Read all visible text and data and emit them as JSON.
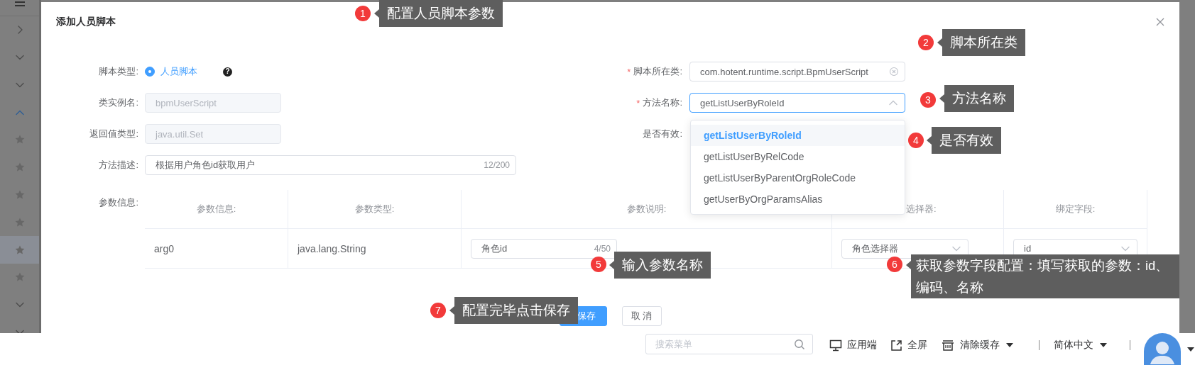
{
  "sidebar": {
    "items": [
      {
        "kind": "menu"
      },
      {
        "kind": "collapse"
      },
      {
        "kind": "group",
        "expanded": false
      },
      {
        "kind": "group",
        "expanded": false
      },
      {
        "kind": "group",
        "expanded": true
      },
      {
        "kind": "page",
        "selected": false
      },
      {
        "kind": "page",
        "selected": false
      },
      {
        "kind": "page",
        "selected": false
      },
      {
        "kind": "page",
        "selected": false
      },
      {
        "kind": "page",
        "selected": true
      },
      {
        "kind": "page",
        "selected": false
      },
      {
        "kind": "group",
        "expanded": false
      },
      {
        "kind": "group",
        "expanded": false
      }
    ]
  },
  "dialog": {
    "title": "添加人员脚本",
    "fields": [
      {
        "kind": "radio",
        "label": "脚本类型:",
        "options": [
          {
            "label": "人员脚本",
            "selected": true
          }
        ],
        "help": "?"
      },
      {
        "kind": "text",
        "required_mark": "*",
        "label": "脚本所在类:",
        "value": "com.hotent.runtime.script.BpmUserScript",
        "disabled": false,
        "clearable": true
      },
      {
        "kind": "text",
        "label": "类实例名:",
        "value": "bpmUserScript",
        "disabled": true
      },
      {
        "kind": "select",
        "required_mark": "*",
        "label": "方法名称:",
        "value": "getListUserByRoleId",
        "expanded": true,
        "options": [
          {
            "label": "getListUserByRoleId",
            "selected": true
          },
          {
            "label": "getListUserByRelCode",
            "selected": false
          },
          {
            "label": "getListUserByParentOrgRoleCode",
            "selected": false
          },
          {
            "label": "getUserByOrgParamsAlias",
            "selected": false
          }
        ]
      },
      {
        "kind": "text",
        "label": "返回值类型:",
        "value": "java.util.Set",
        "disabled": true
      },
      {
        "kind": "hidden",
        "label": "是否有效:"
      },
      {
        "kind": "text",
        "label": "方法描述:",
        "value": "根据用户角色id获取用户",
        "count": "12/200",
        "disabled": false
      }
    ],
    "params": {
      "label": "参数信息:",
      "columns": [
        "参数信息:",
        "参数类型:",
        "参数说明:",
        "选择器:",
        "绑定字段:"
      ],
      "rows": [
        {
          "name": "arg0",
          "type": "java.lang.String",
          "description": {
            "value": "角色id",
            "count": "4/50"
          },
          "selector": {
            "value": "角色选择器"
          },
          "field": {
            "value": "id"
          }
        }
      ]
    },
    "buttons": [
      {
        "kind": "primary",
        "label": "保存"
      },
      {
        "kind": "default",
        "label": "取 消"
      }
    ]
  },
  "annotations": [
    {
      "number": "1",
      "text": "配置人员脚本参数"
    },
    {
      "number": "2",
      "text": "脚本所在类"
    },
    {
      "number": "3",
      "text": "方法名称"
    },
    {
      "number": "4",
      "text": "是否有效"
    },
    {
      "number": "5",
      "text": "输入参数名称"
    },
    {
      "number": "6",
      "text": "获取参数字段配置：填写获取的参数：id、编码、名称"
    },
    {
      "number": "7",
      "text": "配置完毕点击保存"
    }
  ],
  "header_bar": {
    "search": {
      "placeholder": "搜索菜单"
    },
    "items": [
      {
        "kind": "app",
        "label": "应用端"
      },
      {
        "kind": "fullscreen",
        "label": "全屏"
      },
      {
        "kind": "cache",
        "label": "清除缓存",
        "dropdown": true
      },
      {
        "kind": "language",
        "label": "简体中文",
        "dropdown": true
      },
      {
        "kind": "user",
        "dropdown": true
      }
    ]
  }
}
